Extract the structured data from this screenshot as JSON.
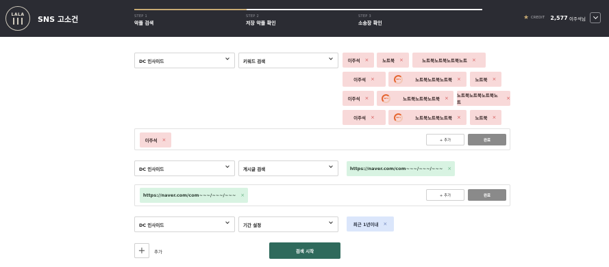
{
  "header": {
    "logo_text": "LALA",
    "app_title": "SNS 고소건",
    "steps": [
      {
        "num": "STEP 1",
        "name": "악플 검색"
      },
      {
        "num": "STEP 2",
        "name": "저장 악플 확인"
      },
      {
        "num": "STEP 3",
        "name": "소송장 확인"
      }
    ],
    "credit_label": "CREDIT",
    "credit_value": "2,577",
    "username": "이주석님"
  },
  "colors": {
    "header_bg": "#2b2c33",
    "accent_gold": "#c8ab74",
    "primary_button": "#2f6a5c",
    "done_button": "#8a8a8a"
  },
  "section1": {
    "platform_select": "DC 인사이드",
    "mode_select": "키워드 검색",
    "keyword_tags": [
      {
        "label": "이주석",
        "loading": false
      },
      {
        "label": "노트북",
        "loading": false
      },
      {
        "label": "노트북노트북노트북노트",
        "loading": false
      },
      {
        "label": "이주석",
        "loading": false
      },
      {
        "label": "노트북노트북노트북",
        "loading": true,
        "progress": "30%"
      },
      {
        "label": "노트북",
        "loading": false
      },
      {
        "label": "이주석",
        "loading": false
      },
      {
        "label": "노트북노트북노트북",
        "loading": true,
        "progress": "30%"
      },
      {
        "label": "노트북노트북노트북노트",
        "loading": false
      },
      {
        "label": "이주석",
        "loading": false
      },
      {
        "label": "노트북노트북노트북",
        "loading": true,
        "progress": "30%"
      },
      {
        "label": "노트북",
        "loading": false
      }
    ],
    "input_tag": "이주석",
    "add_label": "+ 추가",
    "done_label": "완료"
  },
  "section2": {
    "platform_select": "DC 인사이드",
    "mode_select": "게시글 검색",
    "url_tag": "https://naver.com/com~~~/~~~/~~~",
    "input_tag": "https://naver.com/com~~~/~~~/~~~",
    "add_label": "+ 추가",
    "done_label": "완료"
  },
  "section3": {
    "platform_select": "DC 인사이드",
    "mode_select": "기간 설정",
    "period_tag": "최근 1년이내"
  },
  "footer": {
    "add_plus": "+",
    "add_label": "추가",
    "search_label": "검색 시작"
  }
}
